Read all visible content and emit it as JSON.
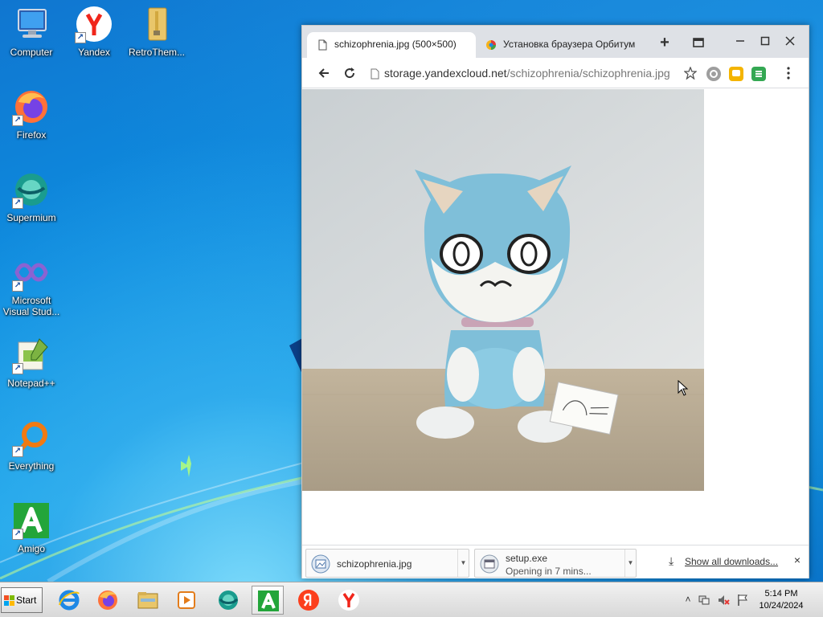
{
  "desktop": {
    "icons": [
      {
        "label": "Computer",
        "icon": "computer-icon"
      },
      {
        "label": "Yandex",
        "icon": "yandex-browser-icon"
      },
      {
        "label": "RetroThem...",
        "icon": "folder-icon"
      },
      {
        "label": "Firefox",
        "icon": "firefox-icon"
      },
      {
        "label": "Supermium",
        "icon": "supermium-icon"
      },
      {
        "label": "Microsoft Visual Stud...",
        "icon": "visual-studio-icon"
      },
      {
        "label": "Notepad++",
        "icon": "notepadpp-icon"
      },
      {
        "label": "Everything",
        "icon": "everything-search-icon"
      },
      {
        "label": "Amigo",
        "icon": "amigo-icon"
      }
    ]
  },
  "browser": {
    "tabs": [
      {
        "label": "schizophrenia.jpg (500×500)",
        "active": true,
        "icon": "page-icon"
      },
      {
        "label": "Установка браузера Орбитум",
        "active": false,
        "icon": "orbitum-icon"
      }
    ],
    "new_tab_label": "+",
    "address": {
      "host": "storage.yandexcloud.net",
      "path": "/schizophrenia/schizophrenia.jpg"
    },
    "extensions": [
      "at-sign-icon",
      "chat-bubble-icon",
      "list-icon"
    ],
    "downloads": [
      {
        "name": "schizophrenia.jpg",
        "status": ""
      },
      {
        "name": "setup.exe",
        "status": "Opening in 7 mins..."
      }
    ],
    "show_all_label": "Show all downloads...",
    "close_shelf_label": "×"
  },
  "taskbar": {
    "start_label": "Start",
    "pinned": [
      "internet-explorer-icon",
      "firefox-icon",
      "file-explorer-icon",
      "media-player-icon",
      "supermium-icon",
      "amigo-icon",
      "yandex-ya-icon",
      "yandex-browser-icon"
    ],
    "active_app": "amigo-icon",
    "clock": {
      "time": "5:14 PM",
      "date": "10/24/2024"
    }
  }
}
